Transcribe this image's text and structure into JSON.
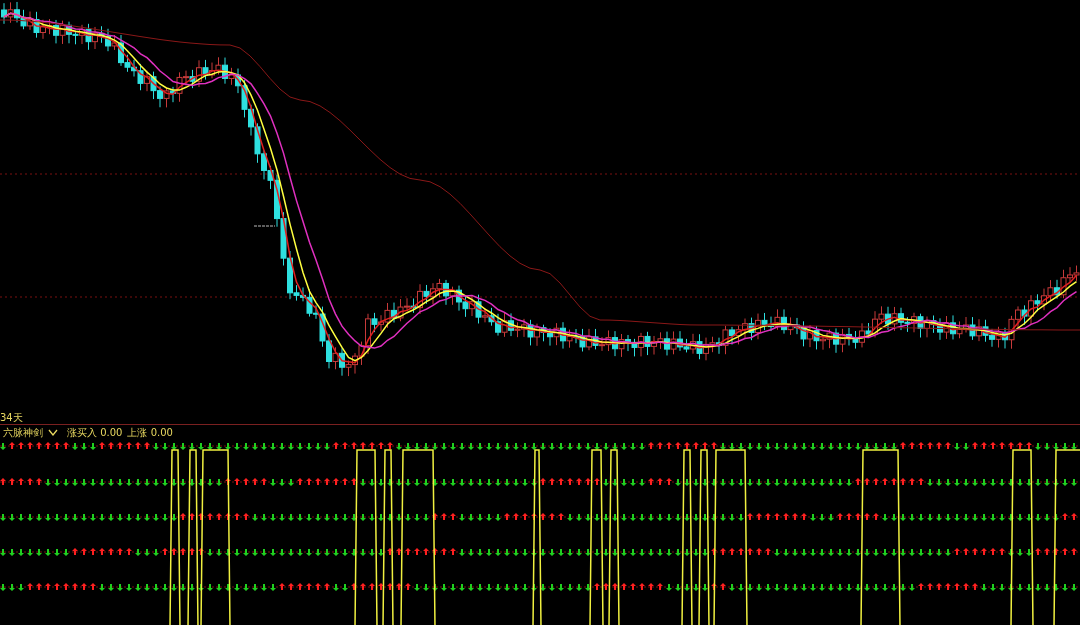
{
  "main_chart": {
    "period_label": "34天"
  },
  "indicator": {
    "name": "六脉神剑",
    "readings": [
      {
        "label": "涨买入 0.00"
      },
      {
        "label": "上涨 0.00"
      }
    ]
  }
}
